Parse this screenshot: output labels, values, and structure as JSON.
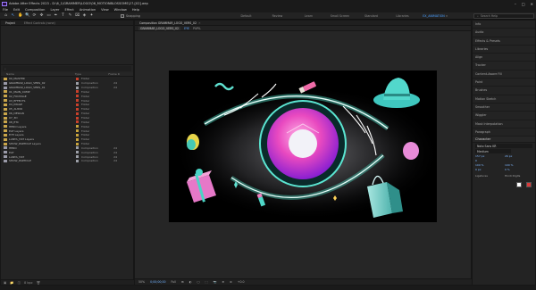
{
  "app": {
    "title": "Adobe After Effects 2023 - D:\\6_1\\GRAMMER\\LOGO\\06_MOTIONBLOSSOMS\\27-[02].aep",
    "window_controls": [
      "–",
      "□",
      "✕"
    ]
  },
  "menu": [
    "File",
    "Edit",
    "Composition",
    "Layer",
    "Effect",
    "Animation",
    "View",
    "Window",
    "Help"
  ],
  "toolbar": {
    "tools": [
      "⌂",
      "↖",
      "✋",
      "🔍",
      "⟳",
      "✥",
      "▭",
      "✒",
      "T",
      "✎",
      "⌧",
      "◈",
      "✦"
    ],
    "snapping_label": "Snapping",
    "workspaces": [
      "Default",
      "Review",
      "Learn",
      "Small Screen",
      "Standard",
      "Libraries"
    ],
    "active_workspace": "EX_ANIMATION",
    "more": "»",
    "search_placeholder": "Search Help"
  },
  "project": {
    "tabs": [
      {
        "label": "Project"
      },
      {
        "label": "Effect Controls (none)"
      }
    ],
    "search_placeholder": "",
    "columns": {
      "name": "Name",
      "type": "Type",
      "size": "Frame R"
    },
    "rows": [
      {
        "name": "00_MASTER",
        "type": "Folder",
        "size": "",
        "kind": "folder",
        "color": "#c9402b"
      },
      {
        "name": "GRAMMAR_LOGO_VERS_02",
        "type": "Composition",
        "size": "24",
        "kind": "comp",
        "color": "#9da0a8"
      },
      {
        "name": "GRAMMAR_LOGO_VERS_01",
        "type": "Composition",
        "size": "24",
        "kind": "comp",
        "color": "#9da0a8"
      },
      {
        "name": "01_MAIN_COMP",
        "type": "Folder",
        "size": "",
        "kind": "folder",
        "color": "#c9402b"
      },
      {
        "name": "02_FOOTAGE",
        "type": "Folder",
        "size": "",
        "kind": "folder",
        "color": "#c9402b"
      },
      {
        "name": "03_EFFECTS",
        "type": "Folder",
        "size": "",
        "kind": "folder",
        "color": "#c9402b"
      },
      {
        "name": "04_IMAGE",
        "type": "Folder",
        "size": "",
        "kind": "folder",
        "color": "#c9402b"
      },
      {
        "name": "05_AUDIO",
        "type": "Folder",
        "size": "",
        "kind": "folder",
        "color": "#c9402b"
      },
      {
        "name": "06_DESIGN",
        "type": "Folder",
        "size": "",
        "kind": "folder",
        "color": "#c9402b"
      },
      {
        "name": "07_3D",
        "type": "Folder",
        "size": "",
        "kind": "folder",
        "color": "#c9402b"
      },
      {
        "name": "08_ETC",
        "type": "Folder",
        "size": "",
        "kind": "folder",
        "color": "#c9402b"
      },
      {
        "name": "HERO Layers",
        "type": "Folder",
        "size": "",
        "kind": "folder",
        "color": "#c9a43c"
      },
      {
        "name": "EAT Layers",
        "type": "Folder",
        "size": "",
        "kind": "folder",
        "color": "#c9a43c"
      },
      {
        "name": "EYE Layers",
        "type": "Folder",
        "size": "",
        "kind": "folder",
        "color": "#c9a43c"
      },
      {
        "name": "LANTA_HAT Layers",
        "type": "Folder",
        "size": "",
        "kind": "folder",
        "color": "#c9a43c"
      },
      {
        "name": "SHOW_PARTICLE Layers",
        "type": "Folder",
        "size": "",
        "kind": "folder",
        "color": "#c9a43c"
      },
      {
        "name": "HERO",
        "type": "Composition",
        "size": "24",
        "kind": "comp",
        "color": "#9da0a8"
      },
      {
        "name": "EAT",
        "type": "Composition",
        "size": "24",
        "kind": "comp",
        "color": "#9da0a8"
      },
      {
        "name": "LANTA_HAT",
        "type": "Composition",
        "size": "24",
        "kind": "comp",
        "color": "#9da0a8"
      },
      {
        "name": "SHOW_PARTICLE",
        "type": "Composition",
        "size": "24",
        "kind": "comp",
        "color": "#9da0a8"
      }
    ],
    "footer": [
      "▣",
      "📁",
      "◫",
      "8 bpc",
      "🗑"
    ]
  },
  "composition": {
    "tab_label": "Composition GRAMMAR_LOGO_VERS_02",
    "subbar": [
      "GRAMMAR_LOGO_VERS_02",
      "EYE",
      "PUPIL"
    ],
    "footer": {
      "zoom": "50%",
      "time": "0;00;00;00",
      "resolution": "Full",
      "extra": [
        "⊞",
        "◐",
        "▢",
        "⬚",
        "📷",
        "⊕",
        "⊗",
        "+0.0"
      ]
    }
  },
  "right_panel": {
    "tabs": [
      "Info",
      "Audio",
      "Effects & Presets",
      "Libraries",
      "Align",
      "Tracker",
      "Content-Aware Fill",
      "Paint",
      "Brushes",
      "Motion Sketch",
      "Smoother",
      "Wiggler",
      "Mask Interpolation",
      "Paragraph"
    ],
    "character": {
      "title": "Character",
      "font": "Noto Sans KR",
      "style": "Medium",
      "size": "157 px",
      "leading": "26 px",
      "tracking": "0",
      "scale_v": "100 %",
      "scale_h": "100 %",
      "baseline": "0 px",
      "tsume": "0 %",
      "ligatures": "Ligatures",
      "hindi": "Hindi Digits"
    }
  },
  "colors": {
    "accent": "#4a9fff",
    "eye_glow": "#4fe0c8",
    "iris_pink": "#f03ea6",
    "background": "#1d1d1d"
  }
}
